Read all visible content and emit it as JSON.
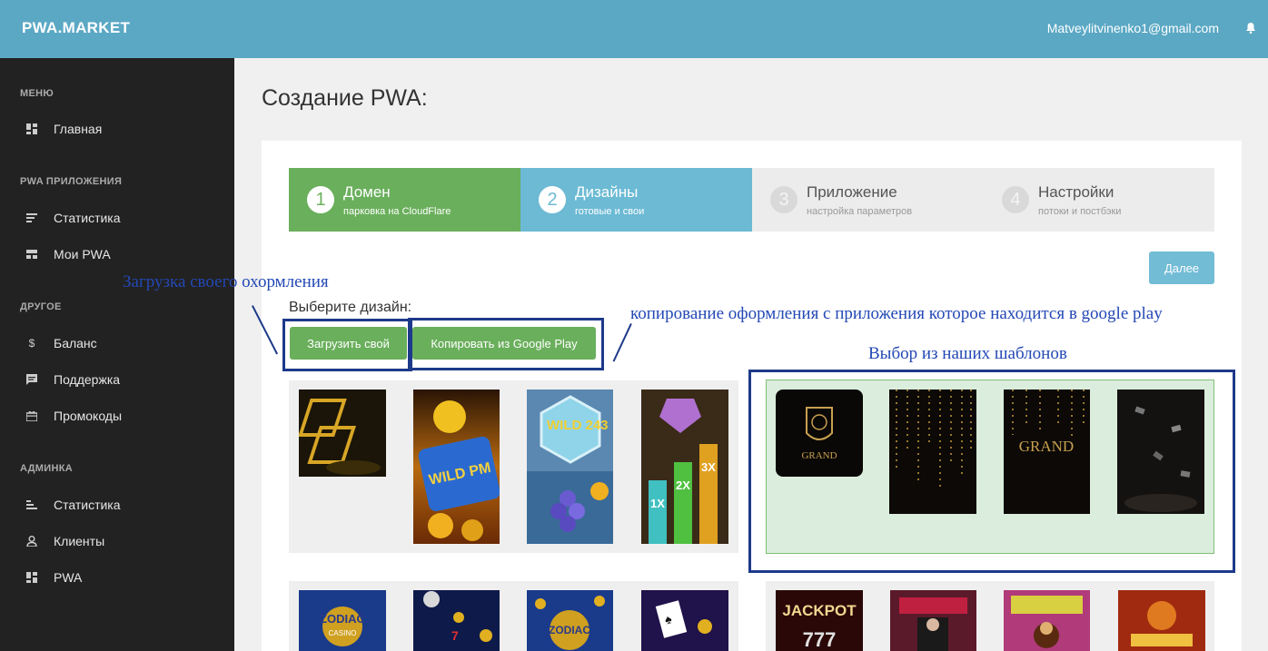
{
  "header": {
    "brand": "PWA.MARKET",
    "user_email": "Matveylitvinenko1@gmail.com"
  },
  "sidebar": {
    "sections": [
      {
        "title": "МЕНЮ",
        "items": [
          {
            "label": "Главная",
            "icon": "dashboard-icon"
          }
        ]
      },
      {
        "title": "PWA ПРИЛОЖЕНИЯ",
        "items": [
          {
            "label": "Статистика",
            "icon": "stats-lines-icon"
          },
          {
            "label": "Мои PWA",
            "icon": "cards-icon"
          }
        ]
      },
      {
        "title": "ДРУГОЕ",
        "items": [
          {
            "label": "Баланс",
            "icon": "dollar-icon"
          },
          {
            "label": "Поддержка",
            "icon": "chat-icon"
          },
          {
            "label": "Промокоды",
            "icon": "gift-icon"
          }
        ]
      },
      {
        "title": "АДМИНКА",
        "items": [
          {
            "label": "Статистика",
            "icon": "bars-icon"
          },
          {
            "label": "Клиенты",
            "icon": "user-icon"
          },
          {
            "label": "PWA",
            "icon": "dashboard-icon"
          }
        ]
      }
    ]
  },
  "page": {
    "title": "Создание PWA:"
  },
  "steps": [
    {
      "num": "1",
      "title": "Домен",
      "sub": "парковка на CloudFlare",
      "state": "done"
    },
    {
      "num": "2",
      "title": "Дизайны",
      "sub": "готовые и свои",
      "state": "active"
    },
    {
      "num": "3",
      "title": "Приложение",
      "sub": "настройка параметров",
      "state": "todo"
    },
    {
      "num": "4",
      "title": "Настройки",
      "sub": "потоки и постбэки",
      "state": "todo"
    }
  ],
  "next_label": "Далее",
  "design": {
    "choose_label": "Выберите дизайн:",
    "upload_label": "Загрузить свой",
    "copy_label": "Копировать из Google Play"
  },
  "annotations": {
    "upload": "Загрузка своего охормления",
    "copy": "копирование оформления с приложения которое находится в google play",
    "templates": "Выбор из наших шаблонов"
  },
  "thumb_text": {
    "wild_pm": "WILD PM",
    "wild243": "WILD 243",
    "x1": "1X",
    "x2": "2X",
    "x3": "3X",
    "grand": "GRAND",
    "zodiac": "ZODIAC",
    "casino": "CASINO",
    "jackpot": "JACKPOT"
  },
  "colors": {
    "header": "#5ba8c4",
    "sidebar": "#222222",
    "done": "#6aaf5c",
    "active": "#6cbad4",
    "annotation": "#1d3a8a"
  }
}
